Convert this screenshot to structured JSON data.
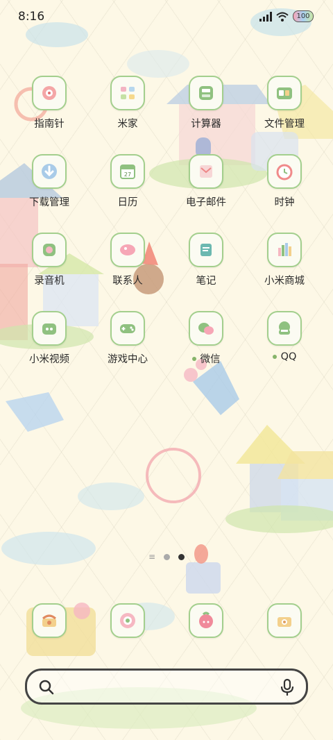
{
  "status": {
    "time": "8:16",
    "battery": "100"
  },
  "apps": [
    {
      "label": "指南针",
      "icon": "compass-icon",
      "dot": false
    },
    {
      "label": "米家",
      "icon": "mijia-icon",
      "dot": false
    },
    {
      "label": "计算器",
      "icon": "calculator-icon",
      "dot": false
    },
    {
      "label": "文件管理",
      "icon": "folder-icon",
      "dot": false
    },
    {
      "label": "下载管理",
      "icon": "download-icon",
      "dot": false
    },
    {
      "label": "日历",
      "icon": "calendar-icon",
      "dot": false,
      "day": "27"
    },
    {
      "label": "电子邮件",
      "icon": "mail-icon",
      "dot": false
    },
    {
      "label": "时钟",
      "icon": "clock-icon",
      "dot": false
    },
    {
      "label": "录音机",
      "icon": "recorder-icon",
      "dot": false
    },
    {
      "label": "联系人",
      "icon": "contacts-icon",
      "dot": false
    },
    {
      "label": "笔记",
      "icon": "notes-icon",
      "dot": false
    },
    {
      "label": "小米商城",
      "icon": "store-icon",
      "dot": false
    },
    {
      "label": "小米视频",
      "icon": "video-icon",
      "dot": false
    },
    {
      "label": "游戏中心",
      "icon": "gamepad-icon",
      "dot": false
    },
    {
      "label": "微信",
      "icon": "wechat-icon",
      "dot": true
    },
    {
      "label": "QQ",
      "icon": "qq-icon",
      "dot": true
    }
  ],
  "dock": [
    {
      "icon": "phone-icon"
    },
    {
      "icon": "browser-icon"
    },
    {
      "icon": "messages-icon"
    },
    {
      "icon": "camera-icon"
    }
  ],
  "pager": {
    "pages": 2,
    "active": 2
  },
  "colors": {
    "tile_border": "#a3cf8d",
    "tile_bg": "#fbfbf2",
    "search_border": "#444444"
  }
}
